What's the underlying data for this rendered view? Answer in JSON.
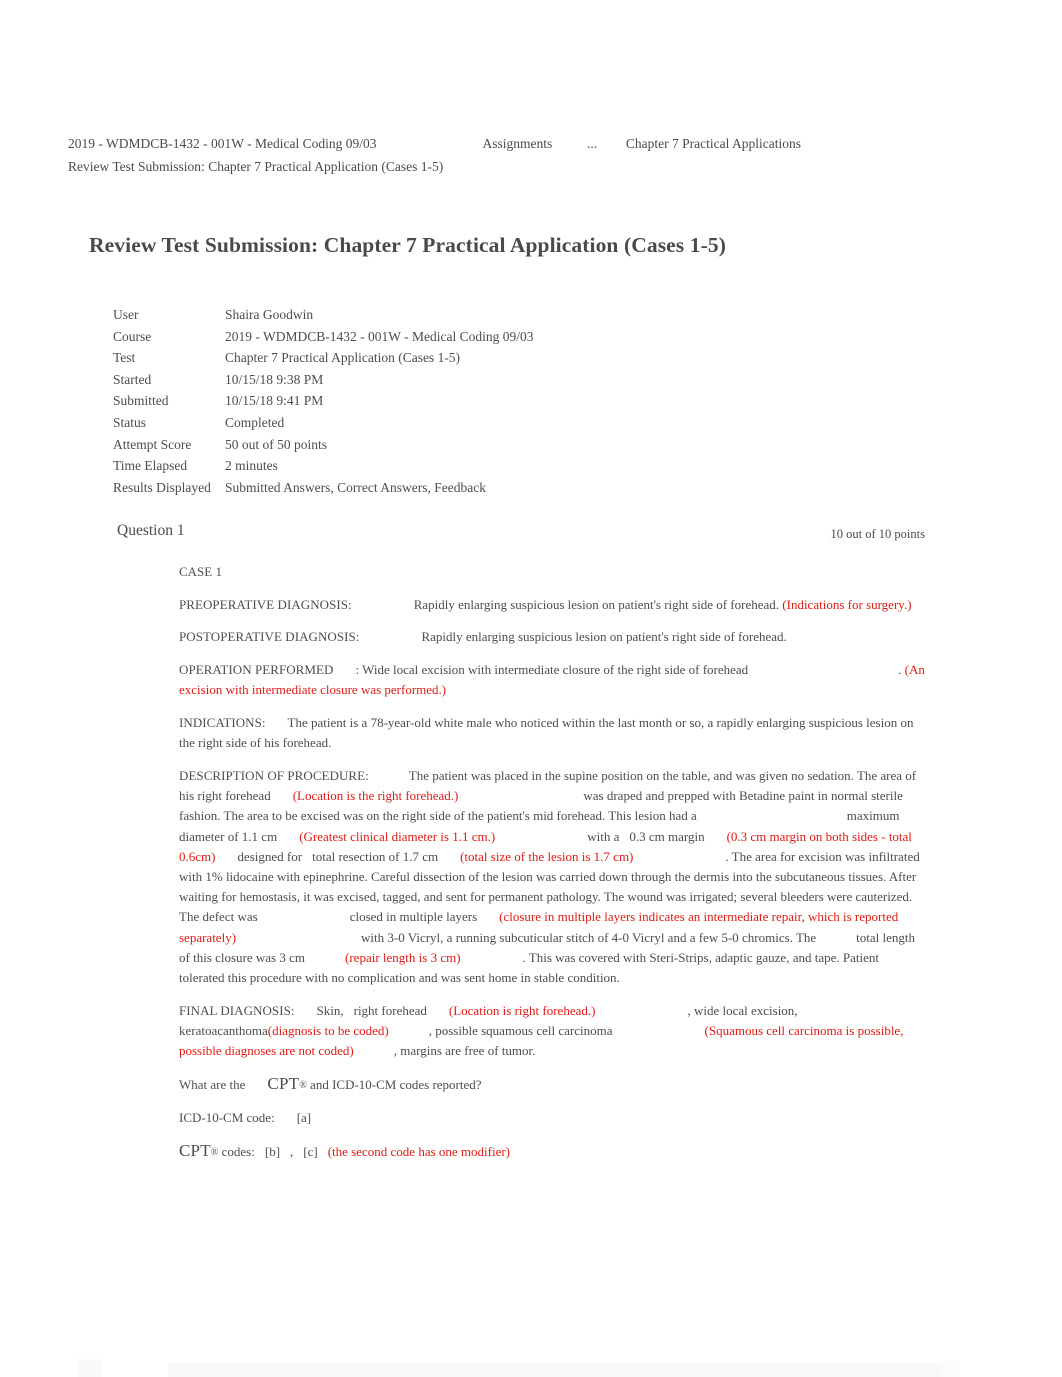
{
  "breadcrumb": {
    "course": "2019 - WDMDCB-1432 - 001W - Medical Coding 09/03",
    "assignments": "Assignments",
    "ellipsis": "...",
    "chapter": "Chapter 7 Practical Applications",
    "current": "Review Test Submission: Chapter 7 Practical Application (Cases 1-5)"
  },
  "page_title": "Review Test Submission: Chapter 7 Practical Application (Cases 1-5)",
  "meta": {
    "rows": [
      {
        "label": "User",
        "value": "Shaira Goodwin"
      },
      {
        "label": "Course",
        "value": "2019 - WDMDCB-1432 - 001W - Medical Coding 09/03"
      },
      {
        "label": "Test",
        "value": "Chapter 7 Practical Application (Cases 1-5)"
      },
      {
        "label": "Started",
        "value": "10/15/18 9:38 PM"
      },
      {
        "label": "Submitted",
        "value": "10/15/18 9:41 PM"
      },
      {
        "label": "Status",
        "value": "Completed"
      },
      {
        "label": "Attempt Score",
        "value": "50 out of 50 points"
      },
      {
        "label": "Time Elapsed",
        "value": "2 minutes"
      },
      {
        "label": "Results Displayed",
        "value": "Submitted Answers, Correct Answers, Feedback"
      }
    ]
  },
  "question": {
    "title": "Question 1",
    "points": "10 out of 10 points",
    "case_label": "CASE 1",
    "preop_label": "PREOPERATIVE DIAGNOSIS:",
    "preop_text": "Rapidly enlarging suspicious lesion on patient's right side of forehead.",
    "preop_note": "(Indications for surgery.)",
    "postop_label": "POSTOPERATIVE DIAGNOSIS:",
    "postop_text": "Rapidly enlarging suspicious lesion on patient's right side of forehead.",
    "operation_label": "OPERATION PERFORMED",
    "operation_text": ": Wide local excision with intermediate closure of the right side of forehead",
    "operation_period": ".",
    "operation_note": "(An excision with intermediate closure was performed.)",
    "indications_label": "INDICATIONS:",
    "indications_text": "The patient is a 78-year-old white male who noticed within the last month or so, a rapidly enlarging suspicious lesion on the right side of his forehead.",
    "desc_label": "DESCRIPTION OF PROCEDURE:",
    "desc_p1": "The patient was placed in the supine position on the table, and was given no sedation. The area of",
    "desc_location": "his right forehead",
    "desc_location_note": "(Location is the right forehead.)",
    "desc_p2": "was draped and prepped with Betadine paint in normal sterile fashion. The area to be excised was on the right side of the patient's mid forehead. This lesion had a",
    "desc_maximum": "maximum diameter of 1.1 cm",
    "desc_diameter_note": "(Greatest clinical diameter is 1.1 cm.)",
    "desc_with_a": "with a",
    "desc_margin": "0.3 cm margin",
    "desc_margin_note": "(0.3 cm margin on both sides - total 0.6cm)",
    "desc_designed": "designed for",
    "desc_resection": "total resection of 1.7 cm",
    "desc_resection_note": "(total size of the lesion is 1.7 cm)",
    "desc_period1": ".",
    "desc_p3": "The area for excision was infiltrated with 1% lidocaine with epinephrine. Careful dissection of the lesion was carried down through the dermis into the subcutaneous tissues. After waiting for hemostasis, it was excised, tagged, and sent for permanent pathology. The wound was irrigated; several bleeders were cauterized. The defect was",
    "desc_closure": "closed in multiple layers",
    "desc_closure_note": "(closure in multiple layers indicates an intermediate repair, which is reported separately)",
    "desc_p4": "with 3-0 Vicryl, a running subcuticular stitch of 4-0 Vicryl and a few 5-0 chromics. The",
    "desc_length": "total length of this closure was 3 cm",
    "desc_length_note": "(repair length is 3 cm)",
    "desc_period2": ".",
    "desc_p5": "This was covered with Steri-Strips, adaptic gauze, and tape. Patient tolerated this procedure with no complication and was sent home in stable condition.",
    "final_label": "FINAL DIAGNOSIS:",
    "final_skin": "Skin,",
    "final_location": "right forehead",
    "final_location_note": "(Location is right forehead.)",
    "final_excision": ", wide local excision,",
    "final_keratoacanthoma": "keratoacanthoma",
    "final_keratoacanthoma_note": "(diagnosis to be coded)",
    "final_possible": ", possible squamous cell carcinoma",
    "final_possible_note": "(Squamous cell carcinoma is possible, possible diagnoses are not coded)",
    "final_margins": ", margins are free of tumor.",
    "prompt_lead": "What are the",
    "prompt_cpt": "CPT",
    "prompt_reg": "®",
    "prompt_tail": "and ICD-10-CM codes reported?",
    "icd_label": "ICD-10-CM code:",
    "icd_blank": "[a]",
    "cpt_label": "CPT",
    "cpt_reg": "®",
    "cpt_label_tail": "codes:",
    "cpt_blank_b": "[b]",
    "cpt_comma": ",",
    "cpt_blank_c": "[c]",
    "cpt_modifier_note": "(the second code has one modifier)"
  },
  "colors": {
    "annotation_red": "#dd1b16",
    "body_text": "#4d4d4d",
    "page_background": "#ffffff"
  }
}
